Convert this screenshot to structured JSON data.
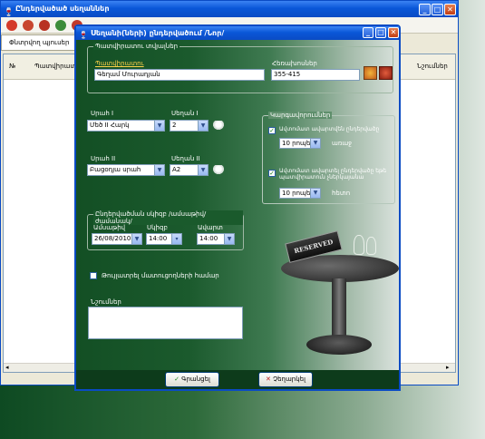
{
  "main_window": {
    "title": "Ընդերվածած սեղաններ",
    "toolbar_tab": "Փնտրվող պյուսեր",
    "columns": [
      "№",
      "Պատվիրատու",
      "Նշումներ"
    ]
  },
  "dialog": {
    "title": "Սեղանի(ների) ընդերվածում /Նոր/",
    "customer_group": "Պատվիրատու տվյալներ",
    "customer_label": "Պատվիրատու",
    "customer_value": "Գեղամ Մուրադյան",
    "phone_label": "Հեռախոսներ",
    "phone_value": "355-415",
    "hall1_label": "Սրահ I",
    "hall1_value": "Մեծ II Հարկ",
    "table1_label": "Սեղան I",
    "table1_value": "2",
    "hall2_label": "Սրահ II",
    "hall2_value": "Բացօդյա սրահ",
    "table2_label": "Սեղան II",
    "table2_value": "A2",
    "reminders_group": "Կարգավորումներ",
    "reminder1_text": "Ավտոմատ ավարտվեն ընդերվածը",
    "reminder1_value": "10 րոպե",
    "reminder1_suffix": "առաջ",
    "reminder2_text": "Ավտոմատ ավարտել ընդերվածը եթե պատվիրատուն չներկայանա",
    "reminder2_value": "10 րոպե",
    "reminder2_suffix": "հետո",
    "datetime_group": "Ընդերվածման սկիզբ /ամսաթիվ/ժամանակ/",
    "date_label": "Ամսաթիվ",
    "date_value": "26/08/2010",
    "from_label": "Սկիզբ",
    "from_value": "14:00",
    "to_label": "Ավարտ",
    "to_value": "14:00",
    "hide_prices_label": "Թույլատրել մատուցողների համար",
    "notes_label": "Նշումներ",
    "notes_value": "",
    "sign_text": "RESERVED",
    "ok_button": "Գրանցել",
    "cancel_button": "Չեղարկել"
  }
}
